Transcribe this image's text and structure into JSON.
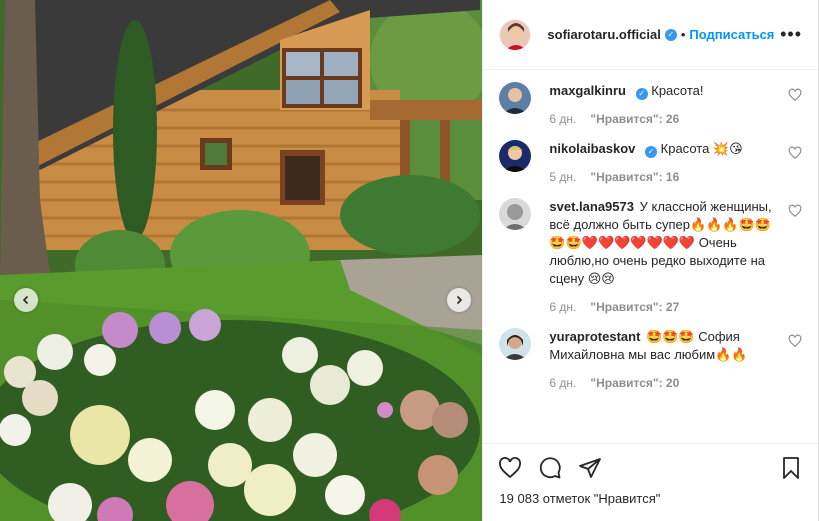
{
  "post": {
    "author": "sofiarotaru.official",
    "follow_label": "Подписаться",
    "separator": "•",
    "likes_text": "19 083 отметок \"Нравится\""
  },
  "comments": [
    {
      "user": "maxgalkinru",
      "verified": true,
      "text": "Красота!",
      "time": "6 дн.",
      "likes": "\"Нравится\": 26"
    },
    {
      "user": "nikolaibaskov",
      "verified": true,
      "text": "Красота 💥😘",
      "time": "5 дн.",
      "likes": "\"Нравится\": 16"
    },
    {
      "user": "svet.lana9573",
      "verified": false,
      "text": "У классной женщины, всё должно быть супер🔥🔥🔥🤩🤩🤩🤩❤️❤️❤️❤️❤️❤️❤️ Очень люблю,но очень редко выходите на сцену 😢😢",
      "time": "6 дн.",
      "likes": "\"Нравится\": 27"
    },
    {
      "user": "yuraprotestant",
      "verified": false,
      "text": "🤩🤩🤩 София Михайловна мы вас любим🔥🔥",
      "time": "6 дн.",
      "likes": "\"Нравится\": 20"
    }
  ],
  "icons": {
    "verified": "✓",
    "more": "•••"
  },
  "colors": {
    "accent": "#0095f6",
    "verified": "#3897f0",
    "muted": "#8e8e8e"
  }
}
